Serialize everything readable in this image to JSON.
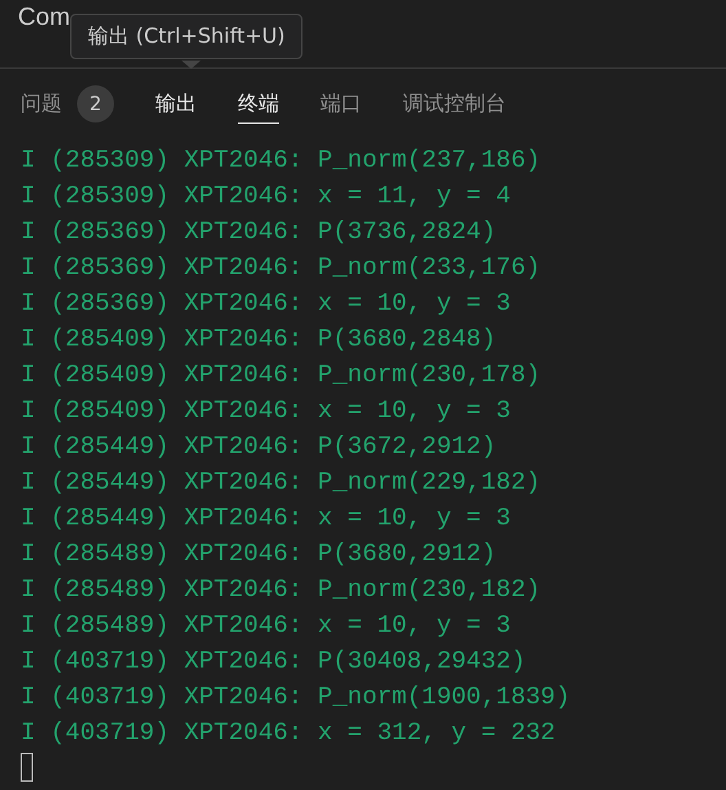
{
  "header": {
    "title": "Com"
  },
  "tooltip": {
    "text": "输出 (Ctrl+Shift+U)"
  },
  "tabs": [
    {
      "label": "问题",
      "badge": "2",
      "selected": false,
      "hovered": false
    },
    {
      "label": "输出",
      "selected": false,
      "hovered": true
    },
    {
      "label": "终端",
      "selected": true,
      "hovered": false
    },
    {
      "label": "端口",
      "selected": false,
      "hovered": false
    },
    {
      "label": "调试控制台",
      "selected": false,
      "hovered": false
    }
  ],
  "terminal": {
    "lines": [
      "I (285309) XPT2046: P_norm(237,186)",
      "I (285309) XPT2046: x = 11, y = 4",
      "I (285369) XPT2046: P(3736,2824)",
      "I (285369) XPT2046: P_norm(233,176)",
      "I (285369) XPT2046: x = 10, y = 3",
      "I (285409) XPT2046: P(3680,2848)",
      "I (285409) XPT2046: P_norm(230,178)",
      "I (285409) XPT2046: x = 10, y = 3",
      "I (285449) XPT2046: P(3672,2912)",
      "I (285449) XPT2046: P_norm(229,182)",
      "I (285449) XPT2046: x = 10, y = 3",
      "I (285489) XPT2046: P(3680,2912)",
      "I (285489) XPT2046: P_norm(230,182)",
      "I (285489) XPT2046: x = 10, y = 3",
      "I (403719) XPT2046: P(30408,29432)",
      "I (403719) XPT2046: P_norm(1900,1839)",
      "I (403719) XPT2046: x = 312, y = 232"
    ]
  }
}
